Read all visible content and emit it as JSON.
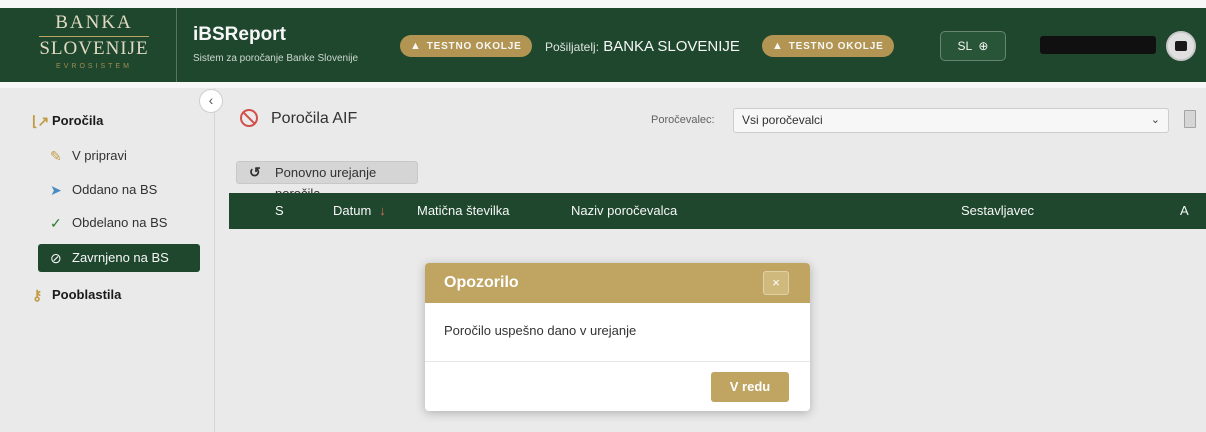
{
  "header": {
    "logo": {
      "line1": "BANKA",
      "line2": "SLOVENIJE",
      "line3": "EVROSISTEM"
    },
    "app_title": "iBSReport",
    "app_subtitle": "Sistem za poročanje Banke Slovenije",
    "env_badge_1": "TESTNO OKOLJE",
    "env_badge_2": "TESTNO OKOLJE",
    "sender_label": "Pošiljatelj:",
    "sender_name": "BANKA SLOVENIJE",
    "lang_label": "SL"
  },
  "sidebar": {
    "sections": [
      {
        "label": "Poročila",
        "icon": "chart-line-icon"
      },
      {
        "label": "Pooblastila",
        "icon": "key-icon"
      }
    ],
    "items": [
      {
        "label": "V pripravi",
        "icon": "edit-icon"
      },
      {
        "label": "Oddano na BS",
        "icon": "send-icon"
      },
      {
        "label": "Obdelano na BS",
        "icon": "check-icon"
      },
      {
        "label": "Zavrnjeno na BS",
        "icon": "ban-icon",
        "active": true
      }
    ]
  },
  "main": {
    "page_title": "Poročila AIF",
    "reporter_label": "Poročevalec:",
    "reporter_value": "Vsi poročevalci",
    "reedit_button": "Ponovno urejanje poročila",
    "columns": [
      "S",
      "Datum",
      "Matična številka",
      "Naziv poročevalca",
      "Sestavljavec",
      "A"
    ]
  },
  "modal": {
    "title": "Opozorilo",
    "message": "Poročilo uspešno dano v urejanje",
    "ok_label": "V redu",
    "close_label": "×"
  },
  "colors": {
    "primary": "#1f4a2f",
    "accent": "#bfa462",
    "danger": "#d9534f"
  }
}
